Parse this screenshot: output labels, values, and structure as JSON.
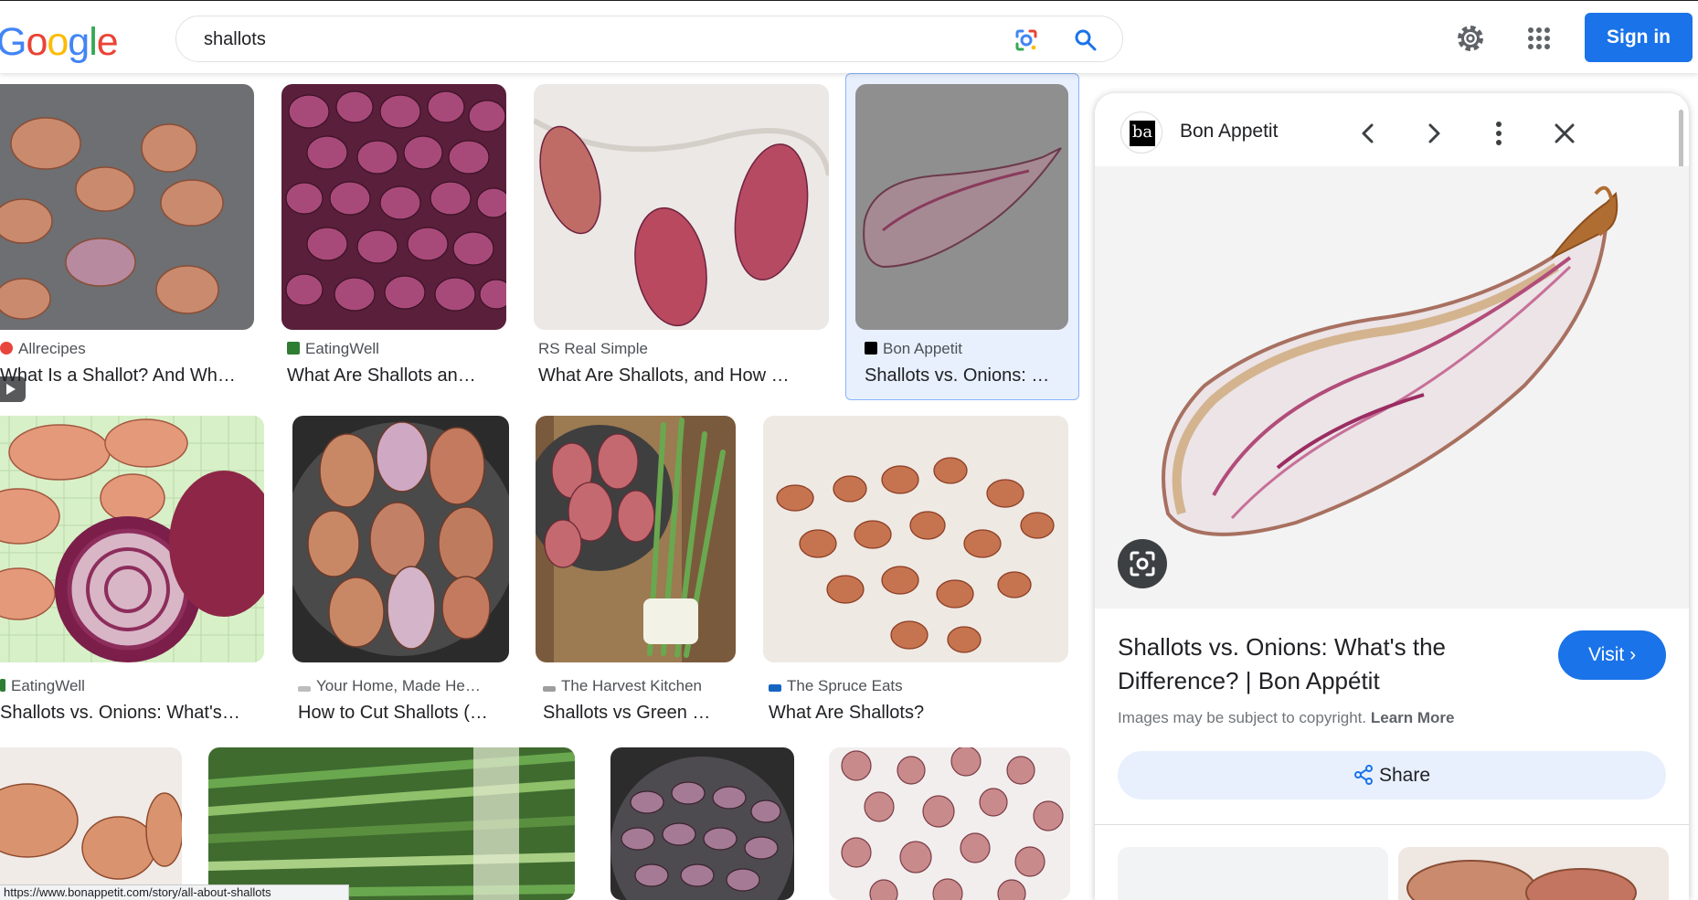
{
  "header": {
    "logo_letters": [
      "G",
      "o",
      "o",
      "g",
      "l",
      "e"
    ],
    "logo_colors": [
      "#4285f4",
      "#ea4335",
      "#fbbc05",
      "#4285f4",
      "#34a853",
      "#ea4335"
    ],
    "query": "shallots",
    "signin_label": "Sign in"
  },
  "results": [
    {
      "source": "Allrecipes",
      "title": "What Is a Shallot? And Wh…",
      "fav_color": "#e8453c"
    },
    {
      "source": "EatingWell",
      "title": "What Are Shallots an…",
      "fav_color": "#2e7d32"
    },
    {
      "source": "RS Real Simple",
      "title": "What Are Shallots, and How …",
      "fav_color": "#e53935"
    },
    {
      "source": "Bon Appetit",
      "title": "Shallots vs. Onions: …",
      "fav_color": "#000000"
    },
    {
      "source": "EatingWell",
      "title": "Shallots vs. Onions: What's t…",
      "fav_color": "#2e7d32"
    },
    {
      "source": "Your Home, Made He…",
      "title": "How to Cut Shallots (…",
      "fav_color": "#9e9e9e"
    },
    {
      "source": "The Harvest Kitchen",
      "title": "Shallots vs Green …",
      "fav_color": "#757575"
    },
    {
      "source": "The Spruce Eats",
      "title": "What Are Shallots?",
      "fav_color": "#1565c0"
    }
  ],
  "status_url": "https://www.bonappetit.com/story/all-about-shallots",
  "panel": {
    "source": "Bon Appetit",
    "logo_text": "ba",
    "title": "Shallots vs. Onions: What's the Difference? | Bon Appétit",
    "visit_label": "Visit ›",
    "copyright_text": "Images may be subject to copyright.",
    "learn_more": "Learn More",
    "share_label": "Share"
  },
  "colors": {
    "accent": "#1a73e8",
    "selected_bg": "#e8f0fe",
    "shallot_skin": "#c77a5c",
    "shallot_purple": "#8e2e5a"
  }
}
